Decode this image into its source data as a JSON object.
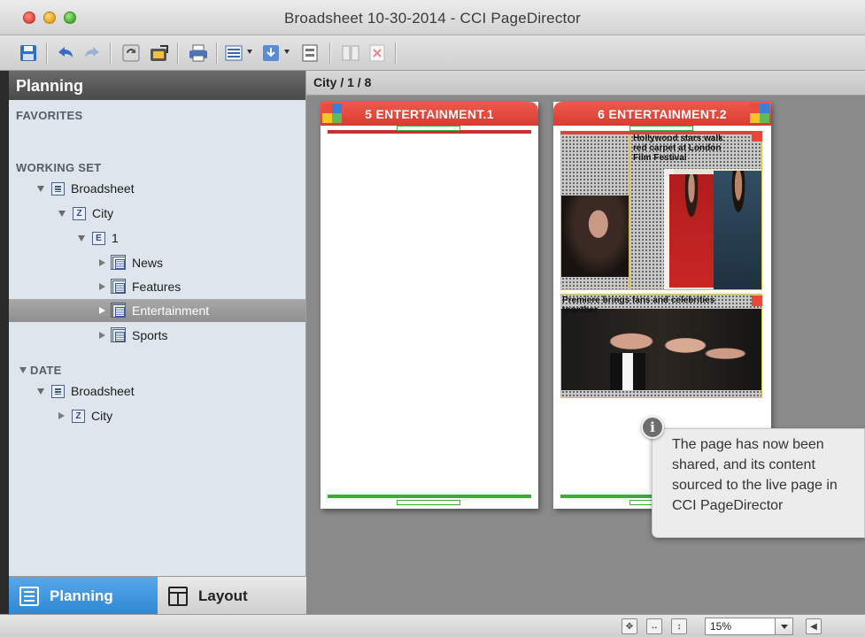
{
  "window": {
    "title": "Broadsheet 10-30-2014 - CCI PageDirector"
  },
  "toolbar": {
    "buttons": [
      "save-icon",
      "undo-icon",
      "redo-icon",
      "refresh-icon",
      "export-icon",
      "print-icon",
      "list-view-icon",
      "import-icon",
      "page-view-icon",
      "columns-icon",
      "delete-icon"
    ]
  },
  "sidebar": {
    "title": "Planning",
    "favorites_label": "FAVORITES",
    "working_set_label": "WORKING SET",
    "working_set": [
      {
        "label": "Broadsheet",
        "level": 1,
        "expanded": true
      },
      {
        "label": "City",
        "level": 2,
        "expanded": true
      },
      {
        "label": "1",
        "level": 3,
        "expanded": true
      },
      {
        "label": "News",
        "level": 4,
        "expanded": false
      },
      {
        "label": "Features",
        "level": 4,
        "expanded": false
      },
      {
        "label": "Entertainment",
        "level": 4,
        "expanded": false,
        "selected": true
      },
      {
        "label": "Sports",
        "level": 4,
        "expanded": false
      }
    ],
    "date_label": "DATE",
    "date_items": [
      {
        "label": "Broadsheet",
        "level": 1,
        "expanded": true
      },
      {
        "label": "City",
        "level": 2,
        "expanded": false
      }
    ],
    "tabs": {
      "planning": "Planning",
      "layout": "Layout"
    }
  },
  "main": {
    "breadcrumb": "City / 1 / 8",
    "pages": [
      {
        "label": "5 ENTERTAINMENT.1"
      },
      {
        "label": "6 ENTERTAINMENT.2"
      }
    ]
  },
  "callout": {
    "icon": "i",
    "text": "The page has now been shared, and its content sourced to the live page in CCI PageDirector"
  },
  "statusbar": {
    "zoom": "15%"
  },
  "colors": {
    "accent": "#2f86d3",
    "page_tab": "#d93b2f",
    "guide": "#3eaa3a"
  }
}
